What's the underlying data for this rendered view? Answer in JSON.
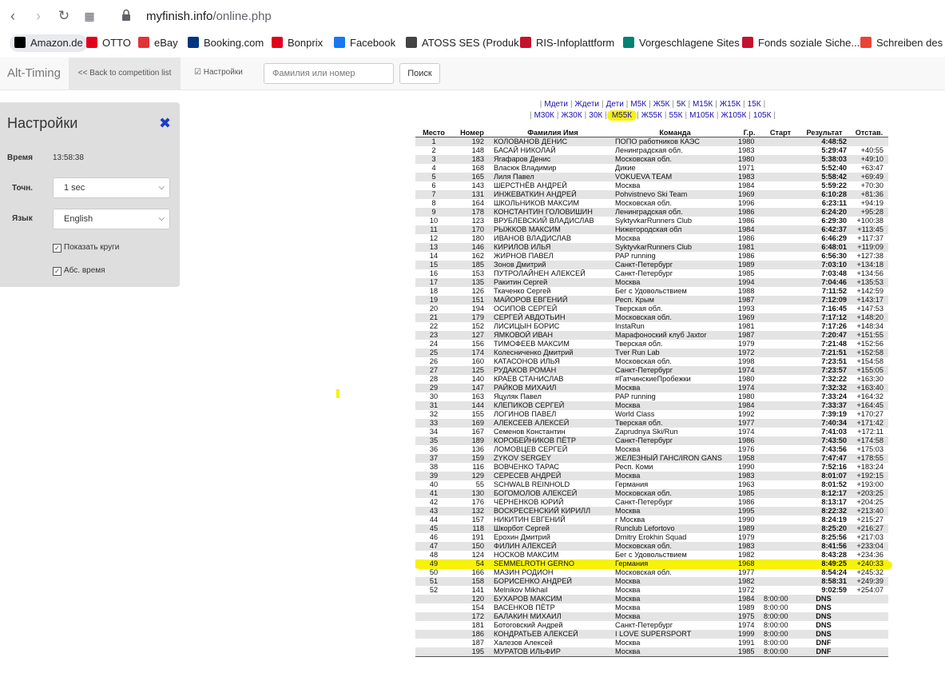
{
  "browser": {
    "url_host": "myfinish.info",
    "url_path": "/online.php",
    "bookmarks": [
      {
        "label": "Amazon.de",
        "icon": "amazon-icon",
        "color": "#000000"
      },
      {
        "label": "OTTO",
        "icon": "otto-icon",
        "color": "#e2001a"
      },
      {
        "label": "eBay",
        "icon": "ebay-icon",
        "color": "#e53238"
      },
      {
        "label": "Booking.com",
        "icon": "booking-icon",
        "color": "#003580"
      },
      {
        "label": "Bonprix",
        "icon": "bonprix-icon",
        "color": "#e2001a"
      },
      {
        "label": "Facebook",
        "icon": "facebook-icon",
        "color": "#1877f2"
      },
      {
        "label": "ATOSS SES (Produk...",
        "icon": "document-icon",
        "color": "#444444"
      },
      {
        "label": "RIS-Infoplattform",
        "icon": "ris-icon",
        "color": "#c8102e"
      },
      {
        "label": "Vorgeschlagene Sites",
        "icon": "bing-icon",
        "color": "#008373"
      },
      {
        "label": "Fonds soziale Siche...",
        "icon": "fonds-icon",
        "color": "#c8102e"
      },
      {
        "label": "Schreiben des F",
        "icon": "gmail-icon",
        "color": "#ea4335"
      }
    ]
  },
  "appbar": {
    "brand": "Alt-Timing",
    "back_link": "<< Back to competition list",
    "settings_link": "Настройки",
    "search_placeholder": "Фамилия или номер",
    "search_button": "Поиск"
  },
  "settings": {
    "title": "Настройки",
    "time_label": "Время",
    "time_value": "13:58:38",
    "precision_label": "Точн.",
    "precision_value": "1 sec",
    "language_label": "Язык",
    "language_value": "English",
    "show_laps": "Показать круги",
    "abs_time": "Абс. время"
  },
  "category_links": {
    "row1": [
      "Мдети",
      "Ждети",
      "Дети",
      "М5К",
      "Ж5К",
      "5К",
      "М15К",
      "Ж15К",
      "15К"
    ],
    "row2": [
      "М30К",
      "Ж30К",
      "30К",
      "М55К",
      "Ж55К",
      "55К",
      "М105К",
      "Ж105К",
      "105К"
    ],
    "selected": "М55К"
  },
  "table": {
    "headers": [
      "Место",
      "Номер",
      "Фамилия Имя",
      "Команда",
      "Г.р.",
      "Старт",
      "Результат",
      "Отстав."
    ],
    "rows": [
      [
        "1",
        "192",
        "КОЛОВАНОВ ДЕНИС",
        "ПОПО работников КАЭС",
        "1980",
        "",
        "4:48:52",
        ""
      ],
      [
        "2",
        "148",
        "БАСАЙ НИКОЛАЙ",
        "Ленинградская обл.",
        "1983",
        "",
        "5:29:47",
        "+40:55"
      ],
      [
        "3",
        "183",
        "Ягафаров Денис",
        "Московская обл.",
        "1980",
        "",
        "5:38:03",
        "+49:10"
      ],
      [
        "4",
        "168",
        "Власюк Владимир",
        "Дикие",
        "1971",
        "",
        "5:52:40",
        "+63:47"
      ],
      [
        "5",
        "165",
        "Лиля Павел",
        "VOKUEVA TEAM",
        "1983",
        "",
        "5:58:42",
        "+69:49"
      ],
      [
        "6",
        "143",
        "ШЕРСТНЁВ АНДРЕЙ",
        "Москва",
        "1984",
        "",
        "5:59:22",
        "+70:30"
      ],
      [
        "7",
        "131",
        "ИНЖЕВАТКИН АНДРЕЙ",
        "Pohvistnevo Ski Team",
        "1969",
        "",
        "6:10:28",
        "+81:36"
      ],
      [
        "8",
        "164",
        "ШКОЛЬНИКОВ МАКСИМ",
        "Московская обл.",
        "1996",
        "",
        "6:23:11",
        "+94:19"
      ],
      [
        "9",
        "178",
        "КОНСТАНТИН ГОЛОВИШИН",
        "Ленинградская обл.",
        "1986",
        "",
        "6:24:20",
        "+95:28"
      ],
      [
        "10",
        "123",
        "ВРУБЛЕВСКИЙ ВЛАДИСЛАВ",
        "SyktyvkarRunners Club",
        "1986",
        "",
        "6:29:30",
        "+100:38"
      ],
      [
        "11",
        "170",
        "РЫЖКОВ МАКСИМ",
        "Нижегородская обл",
        "1984",
        "",
        "6:42:37",
        "+113:45"
      ],
      [
        "12",
        "180",
        "ИВАНОВ ВЛАДИСЛАВ",
        "Москва",
        "1986",
        "",
        "6:46:29",
        "+117:37"
      ],
      [
        "13",
        "146",
        "КИРИЛОВ ИЛЬЯ",
        "SyktyvkarRunners Club",
        "1981",
        "",
        "6:48:01",
        "+119:09"
      ],
      [
        "14",
        "162",
        "ЖИРНОВ ПАВЕЛ",
        "PAP running",
        "1986",
        "",
        "6:56:30",
        "+127:38"
      ],
      [
        "15",
        "185",
        "Зонов Дмитрий",
        "Санкт-Петербург",
        "1989",
        "",
        "7:03:10",
        "+134:18"
      ],
      [
        "16",
        "153",
        "ПУТРОЛАЙНЕН АЛЕКСЕЙ",
        "Санкт-Петербург",
        "1985",
        "",
        "7:03:48",
        "+134:56"
      ],
      [
        "17",
        "135",
        "Ракитин Сергей",
        "Москва",
        "1994",
        "",
        "7:04:46",
        "+135:53"
      ],
      [
        "18",
        "126",
        "Ткаченко Сергей",
        "Бег с Удовольствием",
        "1988",
        "",
        "7:11:52",
        "+142:59"
      ],
      [
        "19",
        "151",
        "МАЙОРОВ ЕВГЕНИЙ",
        "Респ. Крым",
        "1987",
        "",
        "7:12:09",
        "+143:17"
      ],
      [
        "20",
        "194",
        "ОСИПОВ СЕРГЕЙ",
        "Тверская обл.",
        "1993",
        "",
        "7:16:45",
        "+147:53"
      ],
      [
        "21",
        "179",
        "СЕРГЕЙ АВДОТЬИН",
        "Московская обл.",
        "1969",
        "",
        "7:17:12",
        "+148:20"
      ],
      [
        "22",
        "152",
        "ЛИСИЦЫН БОРИС",
        "InstaRun",
        "1981",
        "",
        "7:17:26",
        "+148:34"
      ],
      [
        "23",
        "127",
        "ЯМКОВОЙ ИВАН",
        "Марафоноский клуб Jaxtor",
        "1987",
        "",
        "7:20:47",
        "+151:55"
      ],
      [
        "24",
        "156",
        "ТИМОФЕЕВ МАКСИМ",
        "Тверская обл.",
        "1979",
        "",
        "7:21:48",
        "+152:56"
      ],
      [
        "25",
        "174",
        "Колесниченко Дмитрий",
        "Tver Run Lab",
        "1972",
        "",
        "7:21:51",
        "+152:58"
      ],
      [
        "26",
        "160",
        "КАТАСОНОВ ИЛЬЯ",
        "Московская обл.",
        "1998",
        "",
        "7:23:51",
        "+154:58"
      ],
      [
        "27",
        "125",
        "РУДАКОВ РОМАН",
        "Санкт-Петербург",
        "1974",
        "",
        "7:23:57",
        "+155:05"
      ],
      [
        "28",
        "140",
        "КРАЕВ СТАНИСЛАВ",
        "#ГатчинскиеПробежки",
        "1980",
        "",
        "7:32:22",
        "+163:30"
      ],
      [
        "29",
        "147",
        "РАЙКОВ МИХАИЛ",
        "Москва",
        "1974",
        "",
        "7:32:32",
        "+163:40"
      ],
      [
        "30",
        "163",
        "Яцуляк Павел",
        "PAP running",
        "1980",
        "",
        "7:33:24",
        "+164:32"
      ],
      [
        "31",
        "144",
        "КЛЕПИКОВ СЕРГЕЙ",
        "Москва",
        "1984",
        "",
        "7:33:37",
        "+164:45"
      ],
      [
        "32",
        "155",
        "ЛОГИНОВ ПАВЕЛ",
        "World Class",
        "1992",
        "",
        "7:39:19",
        "+170:27"
      ],
      [
        "33",
        "169",
        "АЛЕКСЕЕВ АЛЕКСЕЙ",
        "Тверская обл.",
        "1977",
        "",
        "7:40:34",
        "+171:42"
      ],
      [
        "34",
        "167",
        "Семенов Константин",
        "Zaprudnya Ski/Run",
        "1974",
        "",
        "7:41:03",
        "+172:11"
      ],
      [
        "35",
        "189",
        "КОРОБЕЙНИКОВ ПЁТР",
        "Санкт-Петербург",
        "1986",
        "",
        "7:43:50",
        "+174:58"
      ],
      [
        "36",
        "136",
        "ЛОМОВЦЕВ СЕРГЕЙ",
        "Москва",
        "1976",
        "",
        "7:43:56",
        "+175:03"
      ],
      [
        "37",
        "159",
        "ZYKOV SERGEY",
        "ЖЕЛЕЗНЫЙ ГАНС/IRON GANS",
        "1958",
        "",
        "7:47:47",
        "+178:55"
      ],
      [
        "38",
        "116",
        "ВОВЧЕНКО ТАРАС",
        "Респ. Коми",
        "1990",
        "",
        "7:52:16",
        "+183:24"
      ],
      [
        "39",
        "129",
        "СЕРЕСЕВ АНДРЕЙ",
        "Москва",
        "1983",
        "",
        "8:01:07",
        "+192:15"
      ],
      [
        "40",
        "55",
        "SCHWALB REINHOLD",
        "Германия",
        "1963",
        "",
        "8:01:52",
        "+193:00"
      ],
      [
        "41",
        "130",
        "БОГОМОЛОВ АЛЕКСЕЙ",
        "Московская обл.",
        "1985",
        "",
        "8:12:17",
        "+203:25"
      ],
      [
        "42",
        "176",
        "ЧЕРНЕНКОВ ЮРИЙ",
        "Санкт-Петербург",
        "1986",
        "",
        "8:13:17",
        "+204:25"
      ],
      [
        "43",
        "132",
        "ВОСКРЕСЕНСКИЙ КИРИЛЛ",
        "Москва",
        "1995",
        "",
        "8:22:32",
        "+213:40"
      ],
      [
        "44",
        "157",
        "НИКИТИН ЕВГЕНИЙ",
        "г Москва",
        "1990",
        "",
        "8:24:19",
        "+215:27"
      ],
      [
        "45",
        "118",
        "Шкорбот Сергей",
        "Runclub Lefortovo",
        "1989",
        "",
        "8:25:20",
        "+216:27"
      ],
      [
        "46",
        "191",
        "Ерохин Дмитрий",
        "Dmitry Erokhin Squad",
        "1979",
        "",
        "8:25:56",
        "+217:03"
      ],
      [
        "47",
        "150",
        "ФИЛИН АЛЕКСЕЙ",
        "Московская обл.",
        "1983",
        "",
        "8:41:56",
        "+233:04"
      ],
      [
        "48",
        "124",
        "НОСКОВ МАКСИМ",
        "Бег с Удовольствием",
        "1982",
        "",
        "8:43:28",
        "+234:36"
      ],
      [
        "49",
        "54",
        "SEMMELROTH GERNO",
        "Германия",
        "1968",
        "",
        "8:49:25",
        "+240:33"
      ],
      [
        "50",
        "166",
        "МАЗИН РОДИОН",
        "Московская обл.",
        "1977",
        "",
        "8:54:24",
        "+245:32"
      ],
      [
        "51",
        "158",
        "БОРИСЕНКО АНДРЕЙ",
        "Москва",
        "1982",
        "",
        "8:58:31",
        "+249:39"
      ],
      [
        "52",
        "141",
        "Melnikov Mikhail",
        "Москва",
        "1972",
        "",
        "9:02:59",
        "+254:07"
      ],
      [
        "",
        "120",
        "БУХАРОВ МАКСИМ",
        "Москва",
        "1984",
        "8:00:00",
        "DNS",
        ""
      ],
      [
        "",
        "154",
        "ВАСЕНКОВ ПЁТР",
        "Москва",
        "1989",
        "8:00:00",
        "DNS",
        ""
      ],
      [
        "",
        "172",
        "БАЛАКИН МИХАИЛ",
        "Москва",
        "1975",
        "8:00:00",
        "DNS",
        ""
      ],
      [
        "",
        "181",
        "Ботоговский Андрей",
        "Санкт-Петербург",
        "1974",
        "8:00:00",
        "DNS",
        ""
      ],
      [
        "",
        "186",
        "КОНДРАТЬЕВ АЛЕКСЕЙ",
        "I LOVE SUPERSPORT",
        "1999",
        "8:00:00",
        "DNS",
        ""
      ],
      [
        "",
        "187",
        "Халезов Алексей",
        "Москва",
        "1991",
        "8:00:00",
        "DNF",
        ""
      ],
      [
        "",
        "195",
        "МУРАТОВ ИЛЬФИР",
        "Москва",
        "1985",
        "8:00:00",
        "DNF",
        ""
      ]
    ],
    "highlighted_place": "49"
  }
}
